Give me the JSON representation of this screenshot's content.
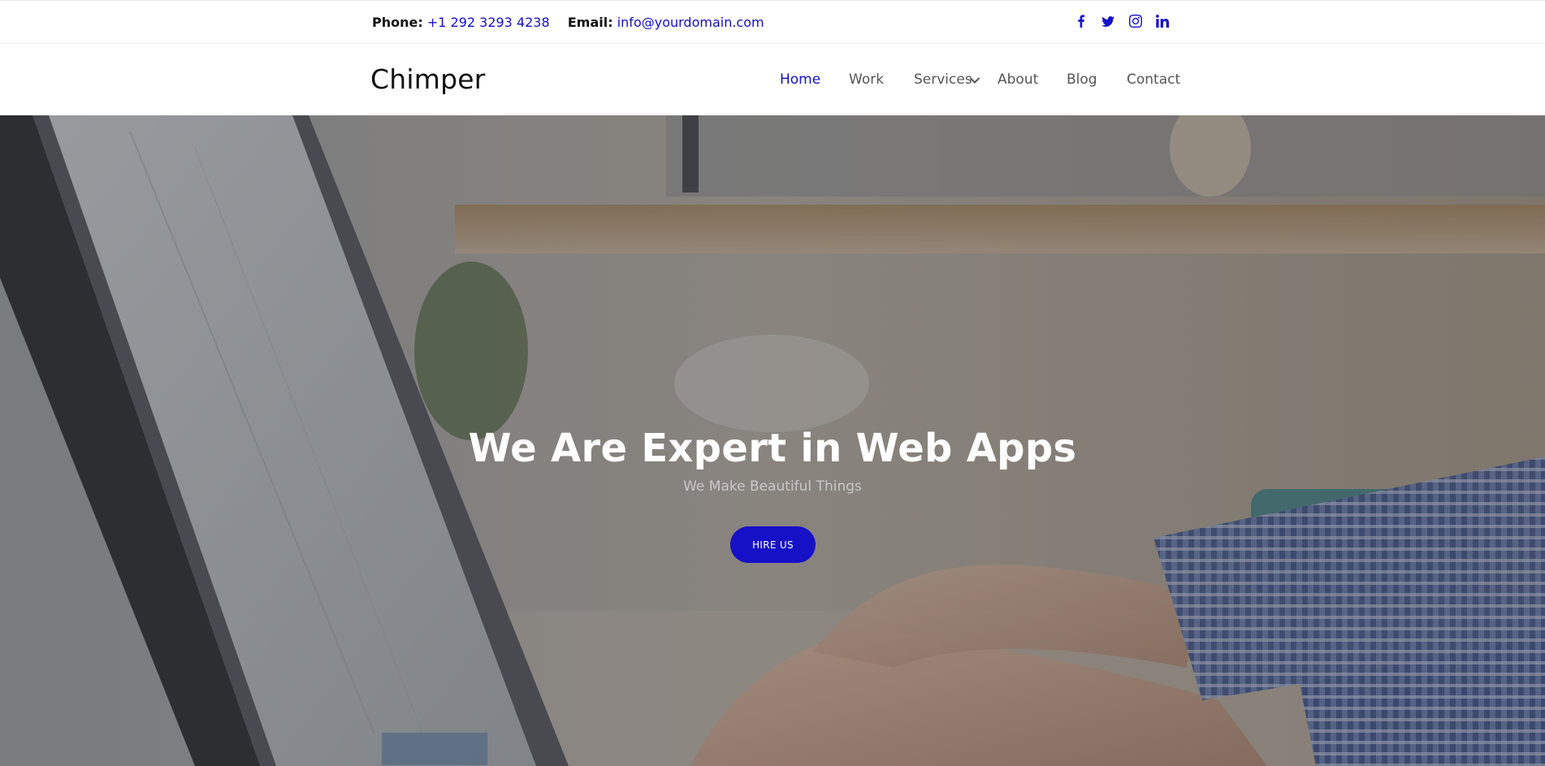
{
  "topbar": {
    "phone_label": "Phone:",
    "phone_value": "+1 292 3293 4238",
    "email_label": "Email:",
    "email_value": "info@yourdomain.com",
    "social": [
      "facebook-icon",
      "twitter-icon",
      "instagram-icon",
      "linkedin-icon"
    ]
  },
  "nav": {
    "brand": "Chimper",
    "items": [
      {
        "label": "Home",
        "active": true
      },
      {
        "label": "Work",
        "active": false
      },
      {
        "label": "Services",
        "active": false,
        "dropdown": true
      },
      {
        "label": "About",
        "active": false
      },
      {
        "label": "Blog",
        "active": false
      },
      {
        "label": "Contact",
        "active": false
      }
    ]
  },
  "hero": {
    "title": "We Are Expert in Web Apps",
    "subtitle": "We Make Beautiful Things",
    "cta_label": "HIRE US"
  },
  "colors": {
    "accent": "#1610c7",
    "nav_text": "#555555",
    "white": "#ffffff"
  }
}
